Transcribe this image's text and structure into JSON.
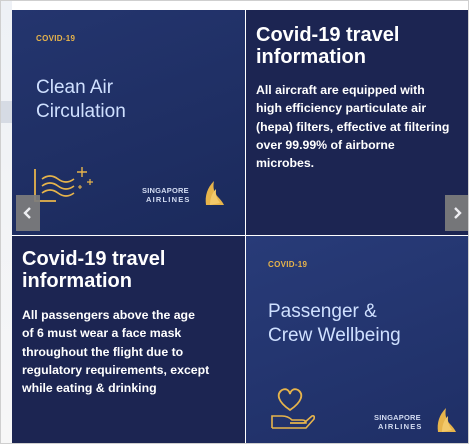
{
  "colors": {
    "tile_dark": "#1c2552",
    "tile_blue": "#24356e",
    "accent_gold": "#e7b44b",
    "promo_text": "#cfe0ff",
    "nav_button": "#7d7d7d"
  },
  "tiles": [
    {
      "tag": "COVID-19",
      "promo": [
        "Clean Air",
        "Circulation"
      ],
      "brand_line1": "SINGAPORE",
      "brand_line2": "AIRLINES",
      "icon": "air-flow-icon"
    },
    {
      "heading": [
        "Covid-19 travel",
        "information"
      ],
      "body": [
        "All aircraft are equipped with",
        "high efficiency particulate air",
        "(hepa) filters, effective at filtering",
        "over 99.99% of airborne",
        "microbes."
      ]
    },
    {
      "heading": [
        "Covid-19 travel",
        "information"
      ],
      "body": [
        "All passengers above the age",
        "of 6 must wear a face mask",
        "throughout the flight due to",
        "regulatory requirements, except",
        "while eating & drinking"
      ]
    },
    {
      "tag": "COVID-19",
      "promo": [
        "Passenger &",
        "Crew Wellbeing"
      ],
      "brand_line1": "SINGAPORE",
      "brand_line2": "AIRLINES",
      "icon": "heart-hand-icon"
    }
  ],
  "nav": {
    "prev_icon": "chevron-left-icon",
    "next_icon": "chevron-right-icon"
  }
}
